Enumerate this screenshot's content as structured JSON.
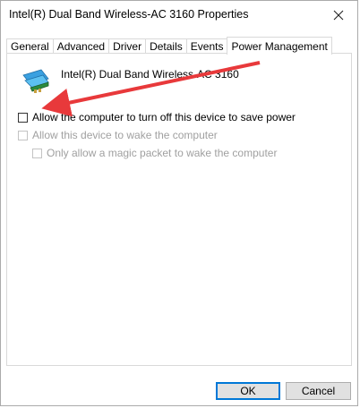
{
  "window": {
    "title": "Intel(R) Dual Band Wireless-AC 3160 Properties"
  },
  "tabs": [
    {
      "label": "General"
    },
    {
      "label": "Advanced"
    },
    {
      "label": "Driver"
    },
    {
      "label": "Details"
    },
    {
      "label": "Events"
    },
    {
      "label": "Power Management"
    }
  ],
  "active_tab": "Power Management",
  "device": {
    "name": "Intel(R) Dual Band Wireless-AC 3160",
    "icon": "network-adapter-icon"
  },
  "options": {
    "allow_turn_off": {
      "label": "Allow the computer to turn off this device to save power",
      "checked": false,
      "enabled": true
    },
    "allow_wake": {
      "label": "Allow this device to wake the computer",
      "checked": false,
      "enabled": false
    },
    "magic_packet": {
      "label": "Only allow a magic packet to wake the computer",
      "checked": false,
      "enabled": false
    }
  },
  "buttons": {
    "ok": "OK",
    "cancel": "Cancel"
  },
  "colors": {
    "annotation_arrow": "#e8393b",
    "default_button_border": "#0078d7",
    "disabled_text": "#a0a0a0"
  }
}
